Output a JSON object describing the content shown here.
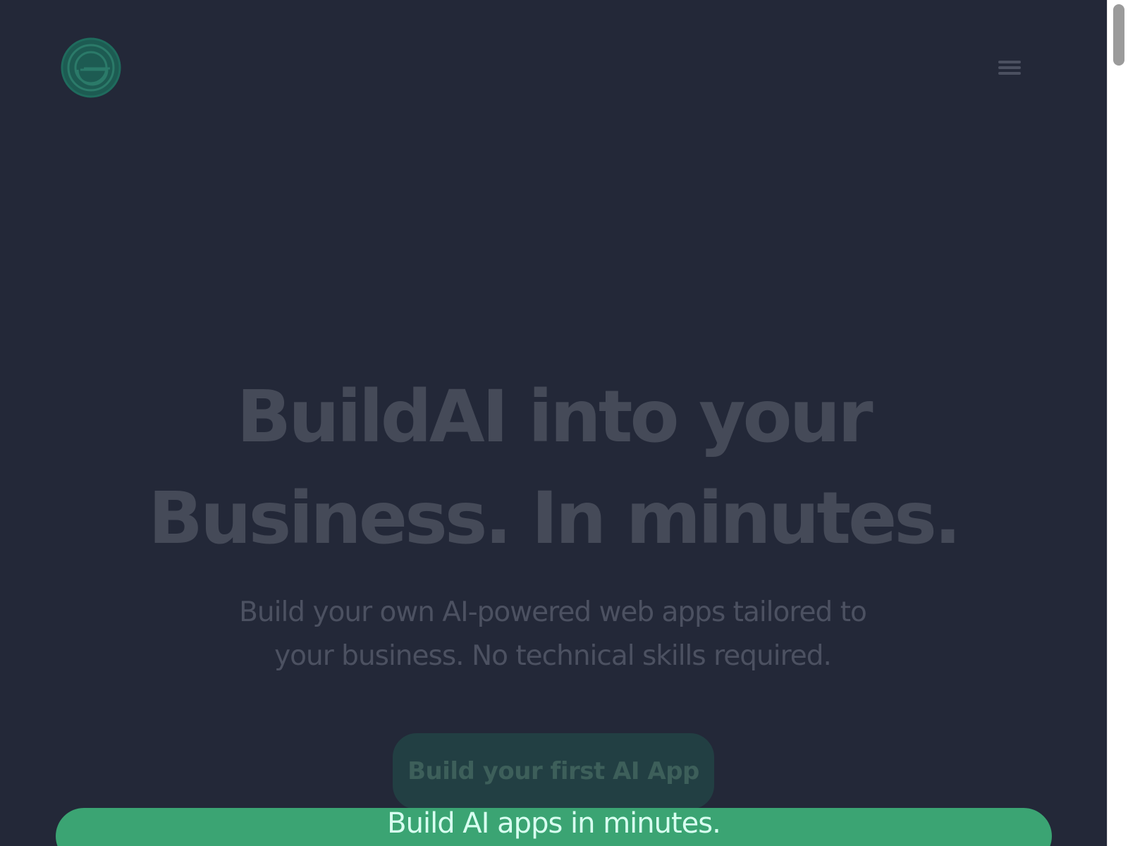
{
  "brand": {
    "logo_icon": "concentric-ring-logo-icon",
    "colors": {
      "background": "#232838",
      "logo": "#1f6b5d",
      "title": "#454a58",
      "subtitle": "#4c5161",
      "cta_background": "#223f43",
      "cta_text": "#3d5f5a",
      "banner_background": "#3ba473",
      "banner_text": "#d8fff0"
    }
  },
  "header": {
    "menu_icon": "hamburger-menu-icon"
  },
  "hero": {
    "title_line_1": "BuildAI into your",
    "title_line_2": "Business. In minutes.",
    "subtitle": "Build your own AI-powered web apps tailored to your business. No technical skills required.",
    "cta_label": "Build your first AI App"
  },
  "banner": {
    "text": "Build AI apps in minutes."
  }
}
